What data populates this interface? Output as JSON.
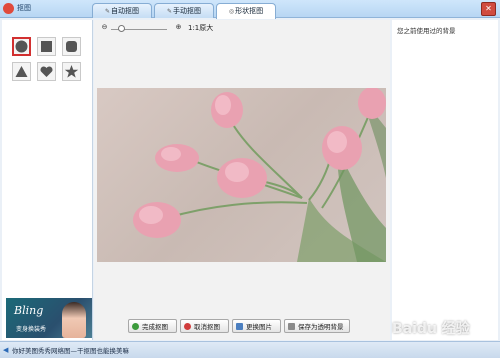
{
  "window": {
    "title": "抠图",
    "close_glyph": "✕"
  },
  "tabs": [
    {
      "label": "自动抠图",
      "icon": "brush-icon"
    },
    {
      "label": "手动抠图",
      "icon": "pen-icon"
    },
    {
      "label": "形状抠图",
      "icon": "shape-icon",
      "active": true
    }
  ],
  "shapes": [
    {
      "name": "circle",
      "selected": true
    },
    {
      "name": "square"
    },
    {
      "name": "rounded-square"
    },
    {
      "name": "triangle"
    },
    {
      "name": "heart"
    },
    {
      "name": "star"
    }
  ],
  "ad": {
    "title": "Bling",
    "subtitle": "变身换装秀"
  },
  "toolbar": {
    "zoom_out_glyph": "⊖",
    "zoom_in_glyph": "⊕",
    "zoom_label": "1:1原大"
  },
  "buttons": {
    "done": "完成抠图",
    "cancel": "取消抠图",
    "replace": "更换图片",
    "save_transparent": "保存为透明背景"
  },
  "right_panel": {
    "recent_title": "您之前使用过的背景"
  },
  "statusbar": {
    "text": "你好美图秀秀网络图—干抠图也能换美嘛"
  },
  "watermark": "Baidu 经验",
  "colors": {
    "selected_border": "#d23030",
    "accent": "#2b6ab7"
  }
}
